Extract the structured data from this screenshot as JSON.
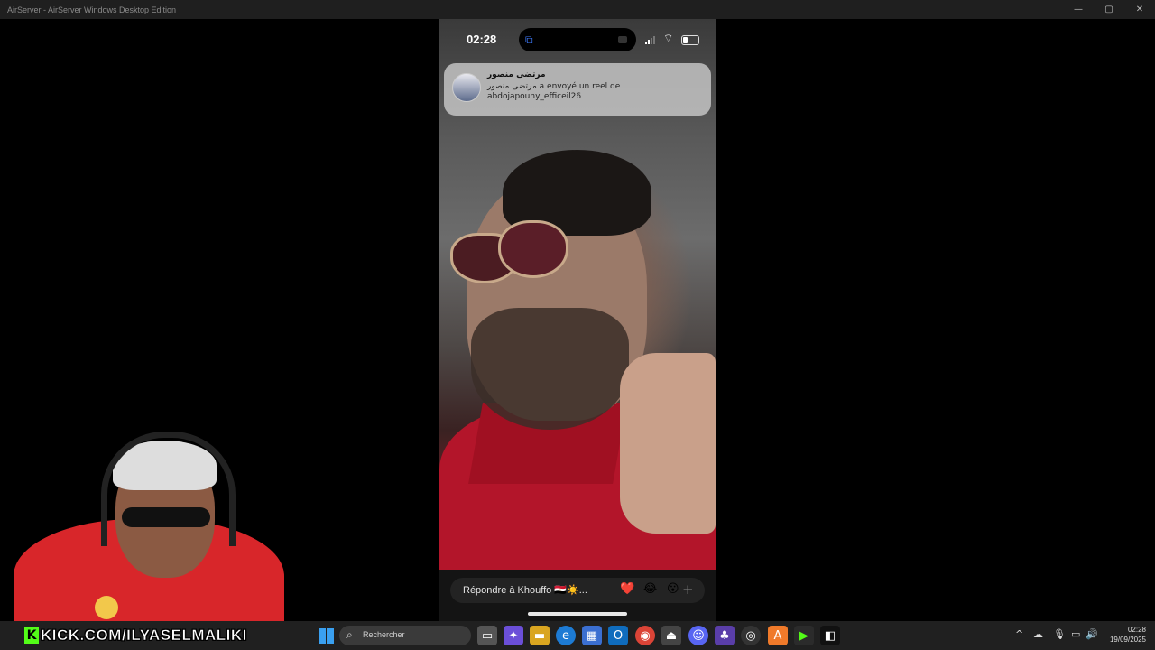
{
  "window": {
    "title": "AirServer - AirServer Windows Desktop Edition",
    "minimize_icon": "—",
    "maximize_icon": "▢",
    "close_icon": "✕"
  },
  "phone": {
    "status": {
      "time": "02:28"
    },
    "notification": {
      "sender": "مرتضى منصور",
      "body": "مرتضى منصور a envoyé un reel de abdojapouny_efficeil26"
    },
    "reply": {
      "placeholder": "Répondre à Khouffo 🇪🇬☀️...",
      "reactions": [
        "❤️",
        "😂",
        "😮"
      ],
      "add": "+"
    }
  },
  "overlay": {
    "kick_letter": "K",
    "kick_url": "KICK.COM/ILYASELMALIKI"
  },
  "taskbar": {
    "search_placeholder": "Rechercher",
    "clock_time": "02:28",
    "clock_date": "19/09/2025"
  },
  "colors": {
    "kick_green": "#53fc18",
    "jersey_red": "#d8262a",
    "taskbar_bg": "#202020"
  }
}
